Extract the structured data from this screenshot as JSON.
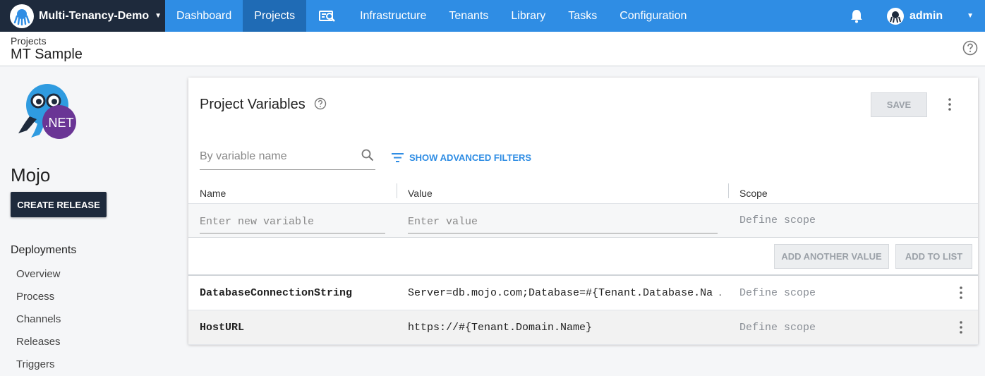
{
  "nav": {
    "space_name": "Multi-Tenancy-Demo",
    "items": [
      {
        "label": "Dashboard",
        "active": false
      },
      {
        "label": "Projects",
        "active": true
      },
      {
        "label": "Infrastructure",
        "active": false
      },
      {
        "label": "Tenants",
        "active": false
      },
      {
        "label": "Library",
        "active": false
      },
      {
        "label": "Tasks",
        "active": false
      },
      {
        "label": "Configuration",
        "active": false
      }
    ],
    "user": "admin",
    "colors": {
      "bar": "#2f8de4",
      "active": "#1f6bb5",
      "space": "#1e2a3c"
    }
  },
  "header": {
    "breadcrumb": "Projects",
    "title": "MT Sample"
  },
  "sidebar": {
    "logo_badge": ".NET",
    "project_name": "Mojo",
    "create_release_label": "CREATE RELEASE",
    "section_label": "Deployments",
    "items": [
      "Overview",
      "Process",
      "Channels",
      "Releases",
      "Triggers"
    ]
  },
  "card": {
    "title": "Project Variables",
    "save_label": "SAVE",
    "search_placeholder": "By variable name",
    "advanced_filters_label": "SHOW ADVANCED FILTERS",
    "columns": {
      "name": "Name",
      "value": "Value",
      "scope": "Scope"
    },
    "new_row": {
      "name_placeholder": "Enter new variable",
      "value_placeholder": "Enter value",
      "scope_placeholder": "Define scope"
    },
    "add_another_value_label": "ADD ANOTHER VALUE",
    "add_to_list_label": "ADD TO LIST",
    "variables": [
      {
        "name": "DatabaseConnectionString",
        "value": "Server=db.mojo.com;Database=#{Tenant.Database.Na …",
        "scope": "Define scope"
      },
      {
        "name": "HostURL",
        "value": "https://#{Tenant.Domain.Name}",
        "scope": "Define scope"
      }
    ]
  }
}
